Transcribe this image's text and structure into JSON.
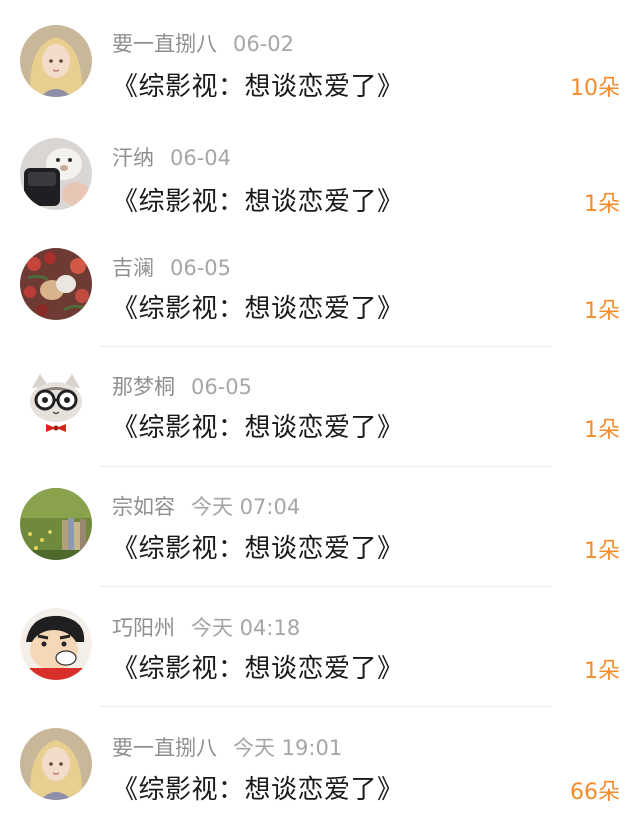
{
  "items": [
    {
      "user": "要一直捌八",
      "time": "06-02",
      "title": "《综影视：想谈恋爱了》",
      "count": "10朵",
      "avatar_icon": "blonde-girl-avatar-icon"
    },
    {
      "user": "汗纳",
      "time": "06-04",
      "title": "《综影视：想谈恋爱了》",
      "count": "1朵",
      "avatar_icon": "plush-toy-avatar-icon"
    },
    {
      "user": "吉澜",
      "time": "06-05",
      "title": "《综影视：想谈恋爱了》",
      "count": "1朵",
      "avatar_icon": "flowers-avatar-icon"
    },
    {
      "user": "那梦桐",
      "time": "06-05",
      "title": "《综影视：想谈恋爱了》",
      "count": "1朵",
      "avatar_icon": "cat-glasses-avatar-icon"
    },
    {
      "user": "宗如容",
      "time": "今天 07:04",
      "title": "《综影视：想谈恋爱了》",
      "count": "1朵",
      "avatar_icon": "meadow-books-avatar-icon"
    },
    {
      "user": "巧阳州",
      "time": "今天 04:18",
      "title": "《综影视：想谈恋爱了》",
      "count": "1朵",
      "avatar_icon": "cartoon-boy-avatar-icon"
    },
    {
      "user": "要一直捌八",
      "time": "今天 19:01",
      "title": "《综影视：想谈恋爱了》",
      "count": "66朵",
      "avatar_icon": "blonde-girl-avatar-icon"
    }
  ]
}
